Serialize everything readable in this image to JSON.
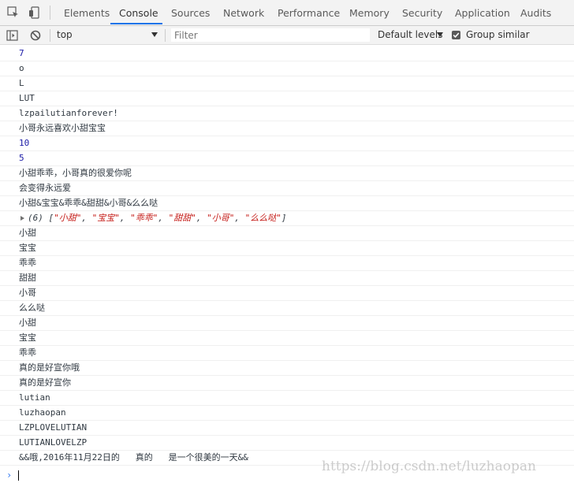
{
  "tabs": [
    "Elements",
    "Console",
    "Sources",
    "Network",
    "Performance",
    "Memory",
    "Security",
    "Application",
    "Audits"
  ],
  "active_tab": "Console",
  "toolbar": {
    "context": "top",
    "filter_placeholder": "Filter",
    "levels": "Default levels",
    "group_similar": "Group similar",
    "group_similar_checked": true
  },
  "messages": [
    {
      "text": "7",
      "kind": "number"
    },
    {
      "text": "o",
      "kind": "text"
    },
    {
      "text": "L",
      "kind": "text"
    },
    {
      "text": "LUT",
      "kind": "text"
    },
    {
      "text": "lzpailutianforever!",
      "kind": "text"
    },
    {
      "text": "小哥永远喜欢小甜宝宝",
      "kind": "text"
    },
    {
      "text": "10",
      "kind": "number"
    },
    {
      "text": "5",
      "kind": "number"
    },
    {
      "text": "小甜乖乖，小哥真的很爱你呢",
      "kind": "text"
    },
    {
      "text": "会变得永远爱",
      "kind": "text"
    },
    {
      "text": "小甜&宝宝&乖乖&甜甜&小哥&么么哒",
      "kind": "text"
    },
    {
      "text": "",
      "kind": "array",
      "count": "(6)",
      "items": [
        "\"小甜\"",
        "\"宝宝\"",
        "\"乖乖\"",
        "\"甜甜\"",
        "\"小哥\"",
        "\"么么哒\""
      ]
    },
    {
      "text": "小甜",
      "kind": "text"
    },
    {
      "text": "宝宝",
      "kind": "text"
    },
    {
      "text": "乖乖",
      "kind": "text"
    },
    {
      "text": "甜甜",
      "kind": "text"
    },
    {
      "text": "小哥",
      "kind": "text"
    },
    {
      "text": "么么哒",
      "kind": "text"
    },
    {
      "text": "小甜",
      "kind": "text"
    },
    {
      "text": "宝宝",
      "kind": "text"
    },
    {
      "text": "乖乖",
      "kind": "text"
    },
    {
      "text": "真的是好宣你哦",
      "kind": "text"
    },
    {
      "text": "真的是好宣你",
      "kind": "text"
    },
    {
      "text": "lutian",
      "kind": "text"
    },
    {
      "text": "luzhaopan",
      "kind": "text"
    },
    {
      "text": "LZPLOVELUTIAN",
      "kind": "text"
    },
    {
      "text": "LUTIANLOVELZP",
      "kind": "text"
    },
    {
      "text": "&&哦,2016年11月22日的   真的   是一个很美的一天&&",
      "kind": "text"
    }
  ],
  "prompt_symbol": "›",
  "watermark": "https://blog.csdn.net/luzhaopan",
  "colors": {
    "accent": "#1a73e8",
    "number": "#1a1aa6",
    "string": "#c41a16",
    "prompt": "#367cf1"
  }
}
